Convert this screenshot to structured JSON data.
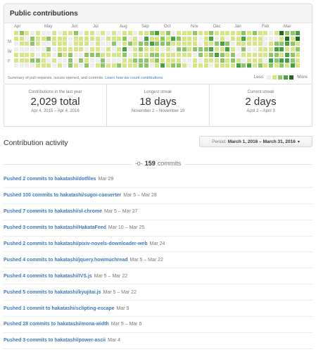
{
  "contributions": {
    "title": "Public contributions",
    "months": [
      "Apr",
      "May",
      "Jun",
      "Jul",
      "Aug",
      "Sep",
      "Oct",
      "Nov",
      "Dec",
      "Jan",
      "Feb",
      "Mar"
    ],
    "days": [
      "M",
      "W",
      "F"
    ],
    "summary_text": "Summary of pull requests, issues opened, and commits.",
    "learn_link": "Learn how we count contributions.",
    "legend_less": "Less",
    "legend_more": "More",
    "colors": [
      "#eeeeee",
      "#d6e685",
      "#8cc665",
      "#44a340",
      "#1e6823"
    ],
    "stats": [
      {
        "label": "Contributions in the last year",
        "value": "2,029 total",
        "range": "Apr 4, 2015 – Apr 4, 2016"
      },
      {
        "label": "Longest streak",
        "value": "18 days",
        "range": "November 2 – November 19"
      },
      {
        "label": "Current streak",
        "value": "2 days",
        "range": "April 2 – April 3"
      }
    ]
  },
  "activity": {
    "title": "Contribution activity",
    "period_label": "Period:",
    "period_value": "March 1, 2016 – March 31, 2016",
    "commit_count": "159",
    "commit_word": "commits",
    "items": [
      {
        "text": "Pushed 2 commits to hakatashi/dotfiles",
        "date": "Mar 29"
      },
      {
        "text": "Pushed 100 commits to hakatashi/sugoi-converter",
        "date": "Mar 5 – Mar 28"
      },
      {
        "text": "Pushed 7 commits to hakatashi/sl-chrome",
        "date": "Mar 5 – Mar 27"
      },
      {
        "text": "Pushed 3 commits to hakatashi/HakataFeed",
        "date": "Mar 10 – Mar 25"
      },
      {
        "text": "Pushed 2 commits to hakatashi/pixiv-novels-downloader-web",
        "date": "Mar 24"
      },
      {
        "text": "Pushed 4 commits to hakatashi/jquery.howmuchread",
        "date": "Mar 5 – Mar 22"
      },
      {
        "text": "Pushed 4 commits to hakatashi/IVS.js",
        "date": "Mar 5 – Mar 22"
      },
      {
        "text": "Pushed 5 commits to hakatashi/kyujitai.js",
        "date": "Mar 5 – Mar 22"
      },
      {
        "text": "Pushed 1 commit to hakatashi/sclipting-escape",
        "date": "Mar 9"
      },
      {
        "text": "Pushed 28 commits to hakatashi/mona-width",
        "date": "Mar 5 – Mar 6"
      },
      {
        "text": "Pushed 3 commits to hakatashi/power-ascii",
        "date": "Mar 4"
      }
    ]
  }
}
